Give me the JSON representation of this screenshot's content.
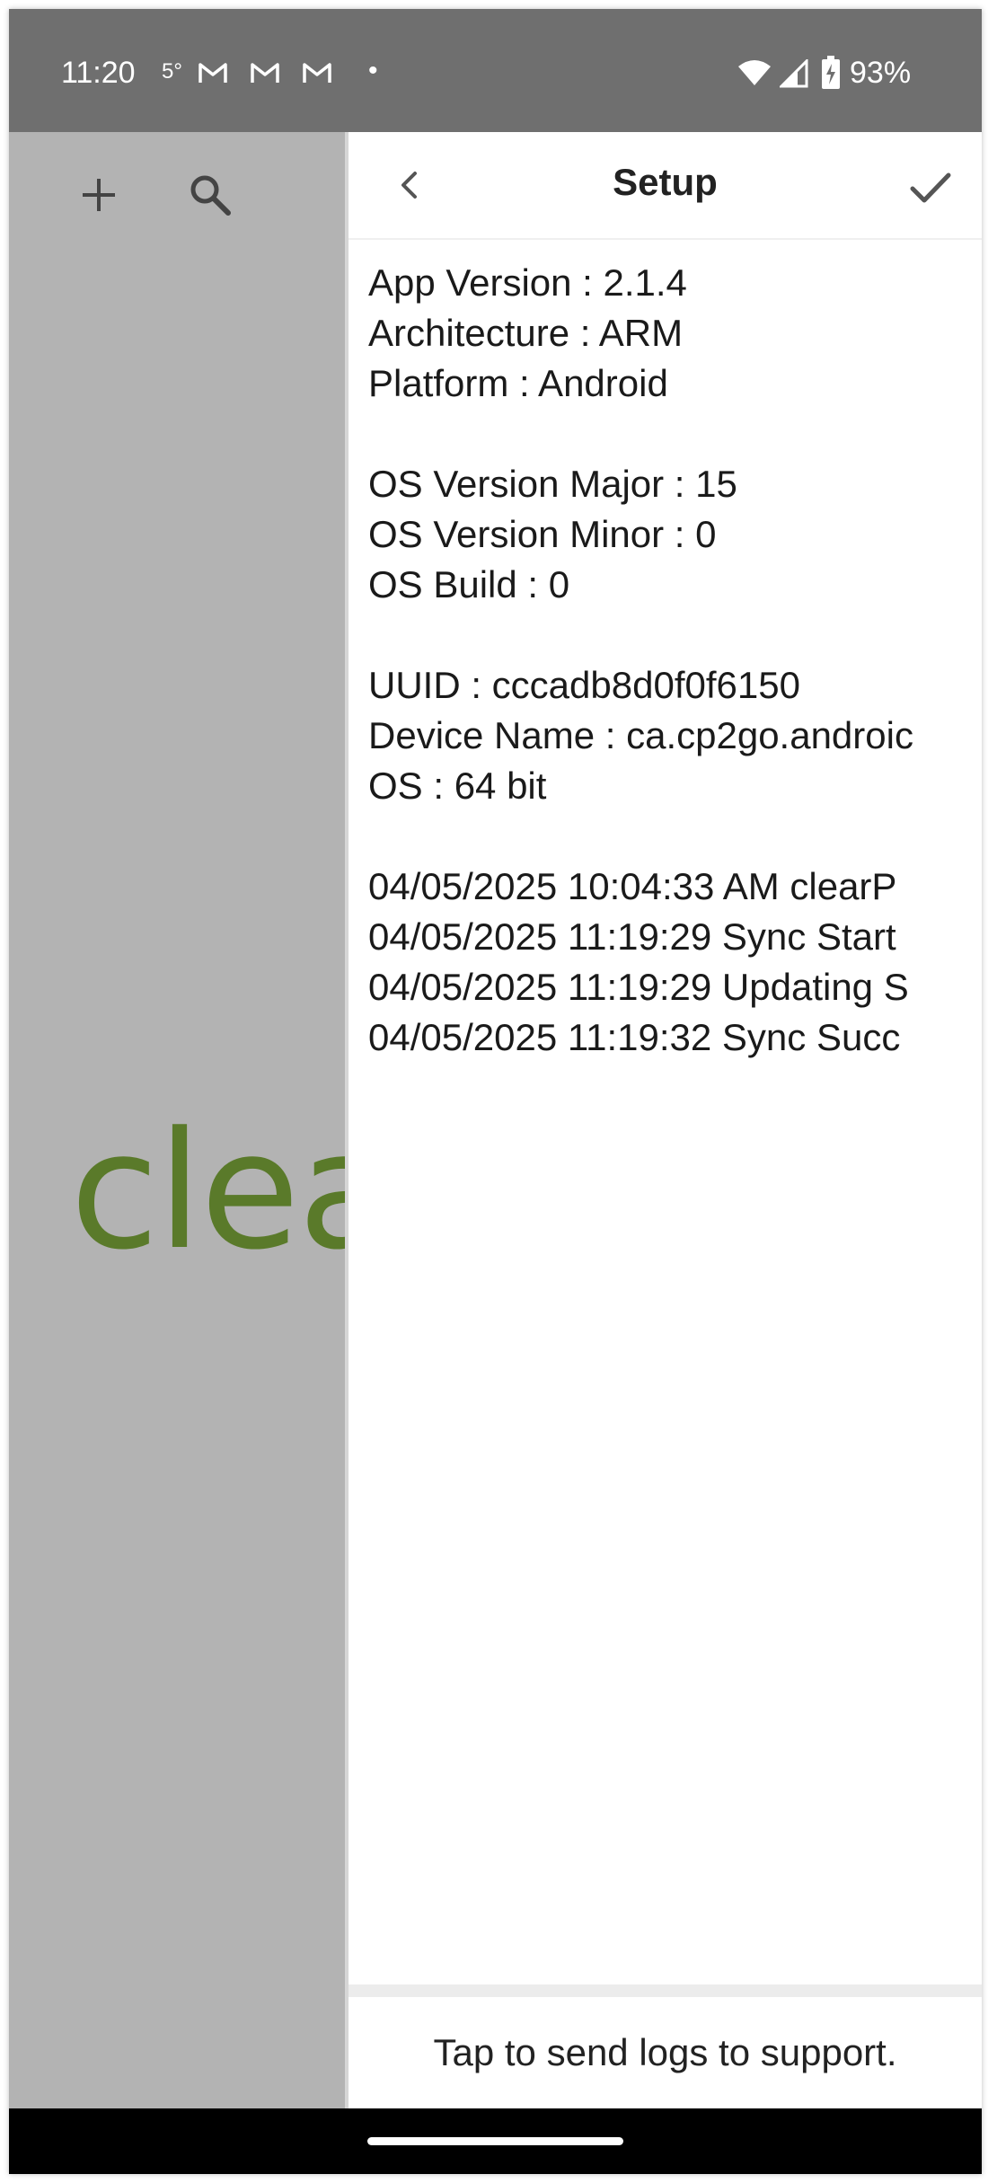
{
  "status_bar": {
    "time": "11:20",
    "temperature": "5°",
    "notification_icons": [
      "gmail-icon",
      "gmail-icon",
      "gmail-icon"
    ],
    "dot": "•",
    "battery_percent": "93%"
  },
  "left_pane": {
    "brand_text": "clea"
  },
  "setup_panel": {
    "title": "Setup",
    "app_version": "App Version : 2.1.4",
    "architecture": "Architecture : ARM",
    "platform": "Platform : Android",
    "os_version_major": "OS Version Major : 15",
    "os_version_minor": "OS Version Minor : 0",
    "os_build": "OS Build : 0",
    "uuid": "UUID : cccadb8d0f0f6150",
    "device_name": "Device Name : ca.cp2go.androic",
    "os": "OS : 64 bit",
    "logs": [
      "04/05/2025 10:04:33 AM clearP",
      "04/05/2025 11:19:29 Sync Start",
      "04/05/2025 11:19:29 Updating S",
      "04/05/2025 11:19:32 Sync Succ"
    ],
    "footer_text": "Tap to send logs to support."
  },
  "colors": {
    "status_bar_bg": "#6f6f6f",
    "left_pane_bg": "#b3b3b3",
    "brand_green": "#5a7a2a",
    "panel_bg": "#ffffff",
    "text": "#1a1a1a"
  }
}
